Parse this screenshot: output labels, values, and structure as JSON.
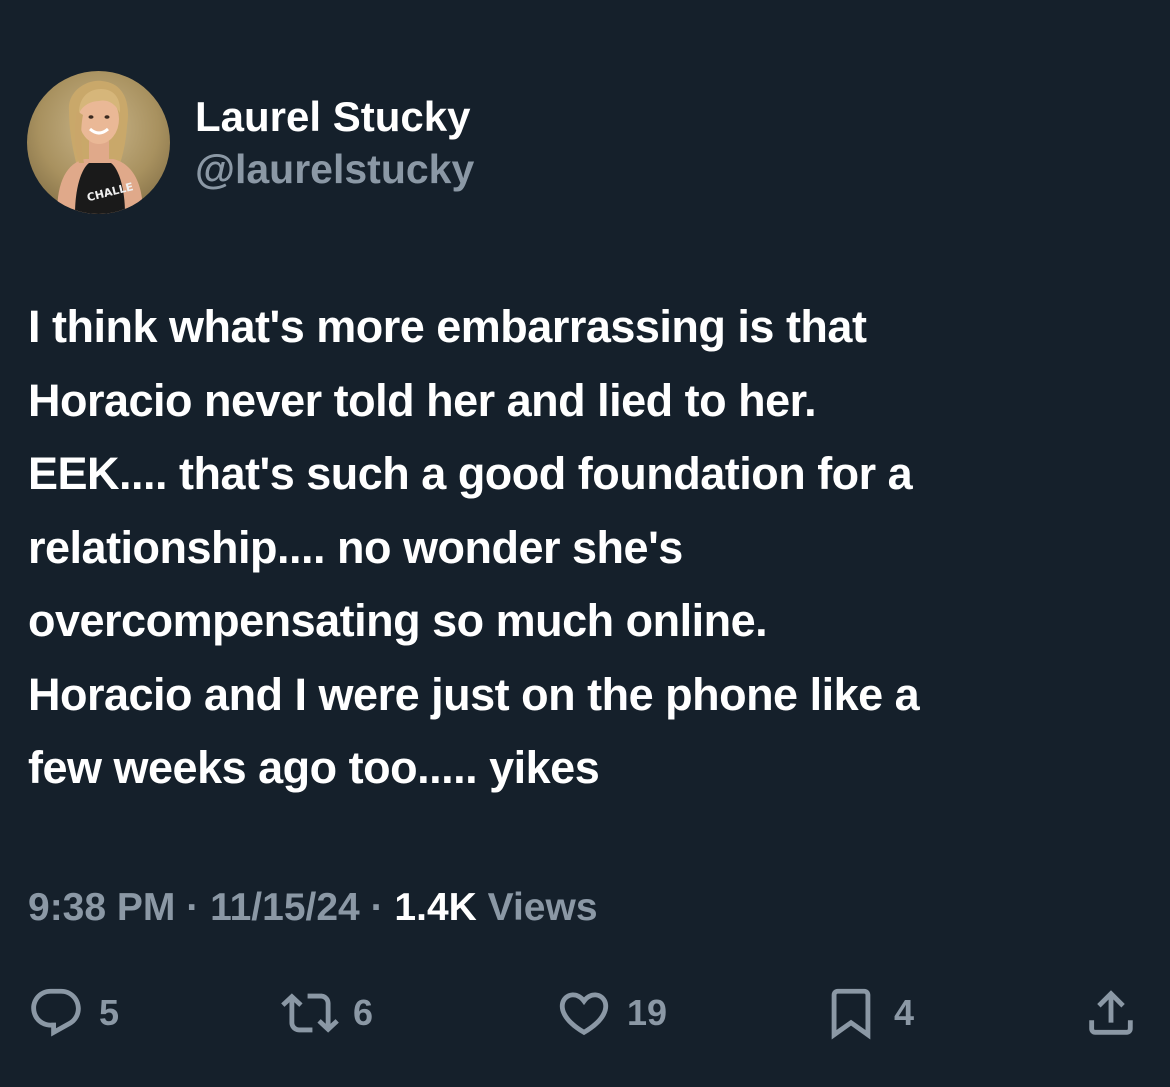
{
  "author": {
    "display_name": "Laurel Stucky",
    "handle": "@laurelstucky",
    "avatar_shirt_text": "CHALLE"
  },
  "tweet": {
    "text": "I think what's more embarrassing is that\nHoracio never told her and lied to her.\nEEK.... that's such a good foundation for a\nrelationship.... no wonder she's\novercompensating so much online.\nHoracio and I were just on the phone like a\nfew weeks ago too..... yikes",
    "time": "9:38 PM",
    "separator": "·",
    "date": "11/15/24",
    "views_count": "1.4K",
    "views_label": "Views"
  },
  "actions": {
    "replies": "5",
    "reposts": "6",
    "likes": "19",
    "bookmarks": "4"
  },
  "colors": {
    "background": "#15202b",
    "primary_text": "#ffffff",
    "secondary_text": "#8b98a5"
  },
  "icons": [
    "reply-icon",
    "repost-icon",
    "like-icon",
    "bookmark-icon",
    "share-icon"
  ]
}
